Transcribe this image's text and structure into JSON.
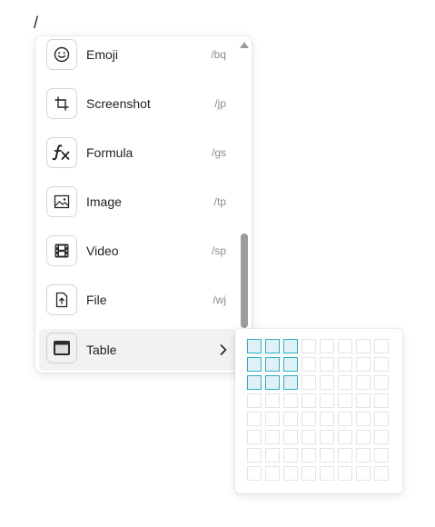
{
  "editor": {
    "slash": "/"
  },
  "menu": {
    "items": [
      {
        "label": "Emoji",
        "shortcut": "/bq",
        "icon": "emoji-icon"
      },
      {
        "label": "Screenshot",
        "shortcut": "/jp",
        "icon": "crop-icon"
      },
      {
        "label": "Formula",
        "shortcut": "/gs",
        "icon": "formula-icon"
      },
      {
        "label": "Image",
        "shortcut": "/tp",
        "icon": "image-icon"
      },
      {
        "label": "Video",
        "shortcut": "/sp",
        "icon": "video-icon"
      },
      {
        "label": "File",
        "shortcut": "/wj",
        "icon": "file-upload-icon"
      },
      {
        "label": "Table",
        "icon": "table-icon",
        "has_submenu": true,
        "active": true
      }
    ]
  },
  "table_picker": {
    "columns": 8,
    "rows": 8,
    "selected_columns": 3,
    "selected_rows": 3,
    "colors": {
      "selected_border": "#2ab0c2",
      "selected_fill": "#dff1f5",
      "cell_border": "#e4e4e4"
    }
  }
}
